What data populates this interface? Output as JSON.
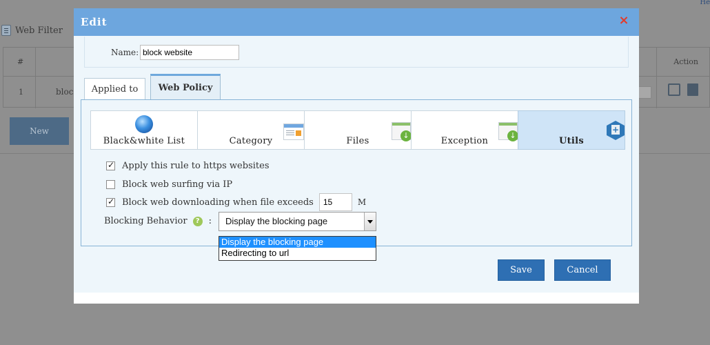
{
  "background": {
    "top_link": "He",
    "page_title": "Web Filter",
    "table": {
      "col_hash": "#",
      "col_action": "Action",
      "row_num": "1",
      "row_name": "bloc",
      "toggle": "ff"
    },
    "new_button": "New"
  },
  "modal": {
    "title": "Edit",
    "close_icon": "×",
    "name_label": "Name:",
    "name_value": "block website",
    "tabs": [
      {
        "label": "Applied to",
        "active": false
      },
      {
        "label": "Web Policy",
        "active": true
      }
    ],
    "categories": [
      {
        "label": "Black&white List",
        "icon": "globe-icon",
        "active": false
      },
      {
        "label": "Category",
        "icon": "category-icon",
        "active": false
      },
      {
        "label": "Files",
        "icon": "files-icon",
        "active": false
      },
      {
        "label": "Exception",
        "icon": "exception-icon",
        "active": false
      },
      {
        "label": "Utils",
        "icon": "utils-icon",
        "active": true
      }
    ],
    "options": [
      {
        "label": "Apply this rule to https websites",
        "checked": true
      },
      {
        "label": "Block web surfing via IP",
        "checked": false
      },
      {
        "label": "Block web downloading when file exceeds",
        "checked": true
      }
    ],
    "file_size_value": "15",
    "file_size_unit": "M",
    "blocking_label": "Blocking Behavior",
    "help_icon": "?",
    "colon": ":",
    "blocking_selected": "Display the blocking page",
    "blocking_options": [
      "Display the blocking page",
      "Redirecting to url"
    ],
    "save_label": "Save",
    "cancel_label": "Cancel"
  },
  "colors": {
    "header": "#6da6de",
    "close": "#e23b2b",
    "button": "#2e6fb3",
    "active_category": "#cfe4f7",
    "dropdown_highlight": "#1e90ff"
  }
}
